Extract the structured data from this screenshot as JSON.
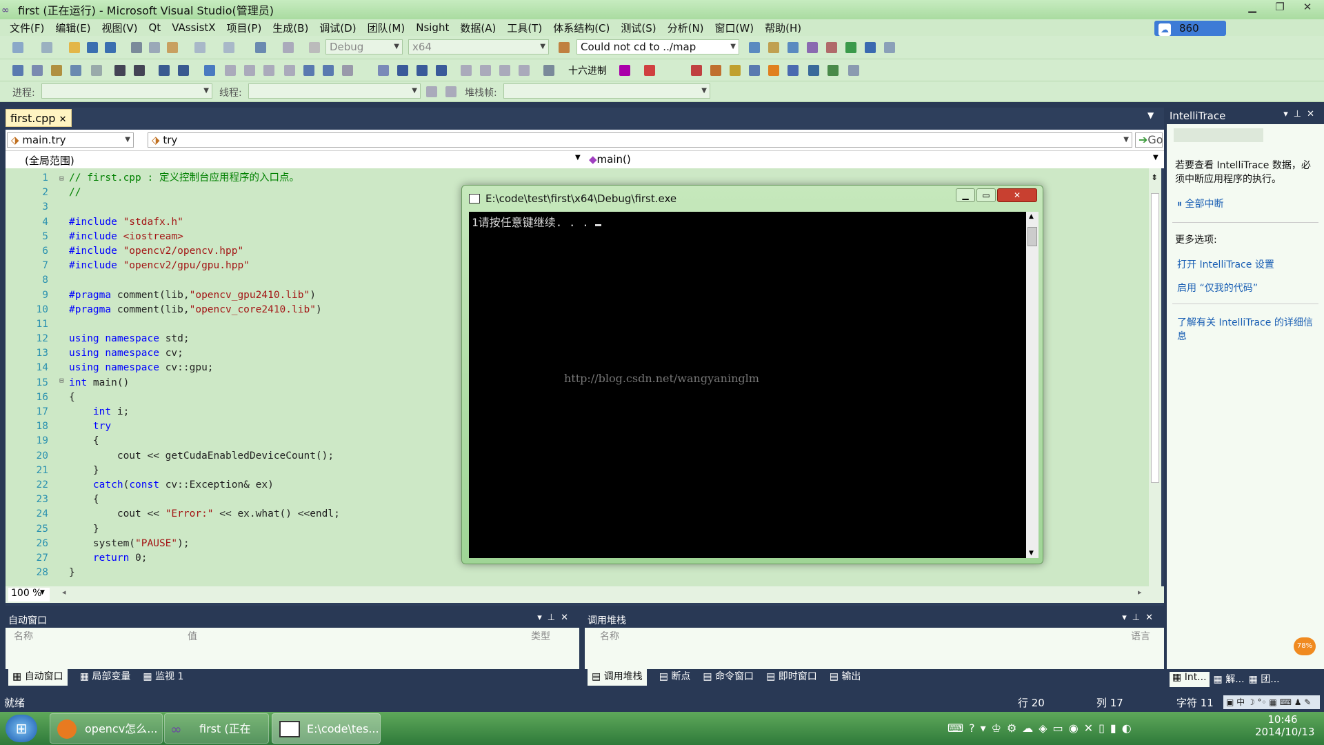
{
  "window": {
    "title": "first (正在运行) - Microsoft Visual Studio(管理员)",
    "net_speed": "860 KB/s"
  },
  "menu": [
    "文件(F)",
    "编辑(E)",
    "视图(V)",
    "Qt",
    "VAssistX",
    "项目(P)",
    "生成(B)",
    "调试(D)",
    "团队(M)",
    "Nsight",
    "数据(A)",
    "工具(T)",
    "体系结构(C)",
    "测试(S)",
    "分析(N)",
    "窗口(W)",
    "帮助(H)"
  ],
  "toolbar": {
    "config": "Debug",
    "platform": "x64",
    "find": "Could not cd to ../map",
    "hex_label": "十六进制",
    "process_label": "进程:",
    "thread_label": "线程:",
    "stackframe_label": "堆栈帧:"
  },
  "editor": {
    "tab": "first.cpp",
    "nav_left": "main.try",
    "nav_right": "try",
    "go_label": "Go",
    "scope": "(全局范围)",
    "member": "main()",
    "zoom": "100 %",
    "line_numbers": [
      "1",
      "2",
      "3",
      "4",
      "5",
      "6",
      "7",
      "8",
      "9",
      "10",
      "11",
      "12",
      "13",
      "14",
      "15",
      "16",
      "17",
      "18",
      "19",
      "20",
      "21",
      "22",
      "23",
      "24",
      "25",
      "26",
      "27",
      "28"
    ]
  },
  "code_lines": [
    "// first.cpp : 定义控制台应用程序的入口点。",
    "//",
    "",
    "#include \"stdafx.h\"",
    "#include <iostream>",
    "#include \"opencv2/opencv.hpp\"",
    "#include \"opencv2/gpu/gpu.hpp\"",
    "",
    "#pragma comment(lib,\"opencv_gpu2410.lib\")",
    "#pragma comment(lib,\"opencv_core2410.lib\")",
    "",
    "using namespace std;",
    "using namespace cv;",
    "using namespace cv::gpu;",
    "int main()",
    "{",
    "    int i;",
    "    try",
    "    {",
    "        cout << getCudaEnabledDeviceCount();",
    "    }",
    "    catch(const cv::Exception& ex)",
    "    {",
    "        cout << \"Error:\" << ex.what() <<endl;",
    "    }",
    "    system(\"PAUSE\");",
    "    return 0;",
    "}"
  ],
  "console": {
    "title": "E:\\code\\test\\first\\x64\\Debug\\first.exe",
    "output": "1请按任意键继续. . . ",
    "watermark": "http://blog.csdn.net/wangyaninglm"
  },
  "auto_window": {
    "title": "自动窗口",
    "columns": [
      "名称",
      "值",
      "类型"
    ],
    "tabs": [
      "自动窗口",
      "局部变量",
      "监视 1"
    ]
  },
  "call_stack": {
    "title": "调用堆栈",
    "columns": [
      "名称",
      "语言"
    ],
    "tabs": [
      "调用堆栈",
      "断点",
      "命令窗口",
      "即时窗口",
      "输出"
    ]
  },
  "intellitrace": {
    "title": "IntelliTrace",
    "hint": "若要查看 IntelliTrace 数据，必须中断应用程序的执行。",
    "break_all": "全部中断",
    "more": "更多选项:",
    "open_settings": "打开 IntelliTrace 设置",
    "enable_my_code": "启用 “仅我的代码”",
    "learn_more": "了解有关 IntelliTrace 的详细信息",
    "bottom_tabs": [
      "Int...",
      "解...",
      "团..."
    ]
  },
  "status": {
    "ready": "就绪",
    "line": "行 20",
    "col": "列 17",
    "char": "字符 11"
  },
  "taskbar": {
    "items": [
      "opencv怎么...",
      "first (正在运...",
      "E:\\code\\tes..."
    ],
    "time": "10:46",
    "date": "2014/10/13",
    "badge": "78%"
  }
}
